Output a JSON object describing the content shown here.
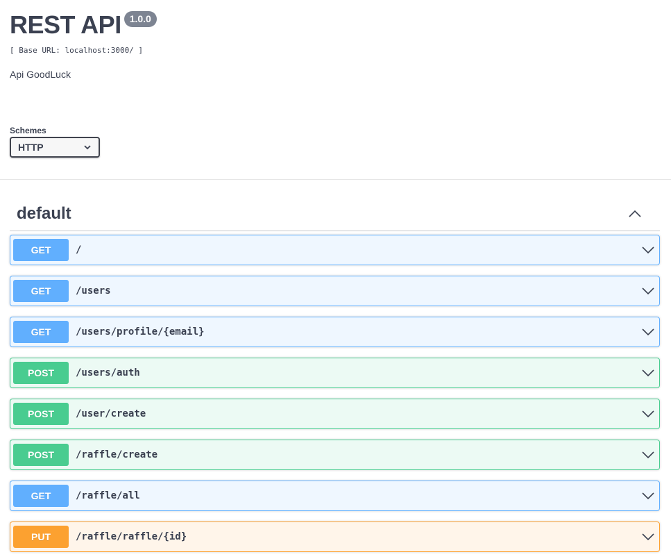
{
  "info": {
    "title": "REST API",
    "version": "1.0.0",
    "base_url": "[ Base URL: localhost:3000/ ]",
    "description": "Api GoodLuck"
  },
  "schemes": {
    "label": "Schemes",
    "selected": "HTTP"
  },
  "tag": {
    "name": "default",
    "toggle_icon": "chevron-up-icon"
  },
  "operations": [
    {
      "method": "GET",
      "path": "/"
    },
    {
      "method": "GET",
      "path": "/users"
    },
    {
      "method": "GET",
      "path": "/users/profile/{email}"
    },
    {
      "method": "POST",
      "path": "/users/auth"
    },
    {
      "method": "POST",
      "path": "/user/create"
    },
    {
      "method": "POST",
      "path": "/raffle/create"
    },
    {
      "method": "GET",
      "path": "/raffle/all"
    },
    {
      "method": "PUT",
      "path": "/raffle/raffle/{id}"
    }
  ],
  "colors": {
    "get": "#61affe",
    "post": "#49cc90",
    "put": "#fca130",
    "text": "#3b4151",
    "version_badge": "#7d8492"
  }
}
